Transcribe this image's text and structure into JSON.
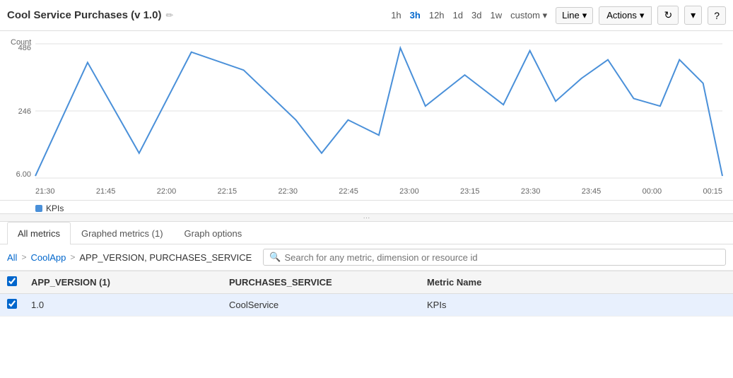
{
  "header": {
    "title": "Cool Service Purchases (v 1.0)",
    "edit_icon": "✏",
    "time_options": [
      "1h",
      "3h",
      "12h",
      "1d",
      "3d",
      "1w",
      "custom ▾"
    ],
    "active_time": "3h",
    "chart_type": "Line",
    "actions_label": "Actions",
    "refresh_icon": "↻",
    "dropdown_icon": "▾",
    "help_icon": "?"
  },
  "chart": {
    "count_label": "Count",
    "y_labels": [
      "486",
      "246",
      "6.00"
    ],
    "x_labels": [
      "21:30",
      "21:45",
      "22:00",
      "22:15",
      "22:30",
      "22:45",
      "23:00",
      "23:15",
      "23:30",
      "23:45",
      "00:00",
      "00:15"
    ],
    "legend_label": "KPIs",
    "resize_handle": "···"
  },
  "tabs": [
    {
      "label": "All metrics",
      "active": true
    },
    {
      "label": "Graphed metrics (1)",
      "active": false
    },
    {
      "label": "Graph options",
      "active": false
    }
  ],
  "breadcrumb": {
    "all": "All",
    "sep1": ">",
    "app": "CoolApp",
    "sep2": ">",
    "current": "APP_VERSION, PURCHASES_SERVICE",
    "search_placeholder": "Search for any metric, dimension or resource id"
  },
  "table": {
    "headers": [
      "",
      "APP_VERSION (1)",
      "PURCHASES_SERVICE",
      "Metric Name"
    ],
    "rows": [
      {
        "checked": true,
        "version": "1.0",
        "service": "CoolService",
        "metric": "KPIs",
        "selected": true
      }
    ]
  }
}
